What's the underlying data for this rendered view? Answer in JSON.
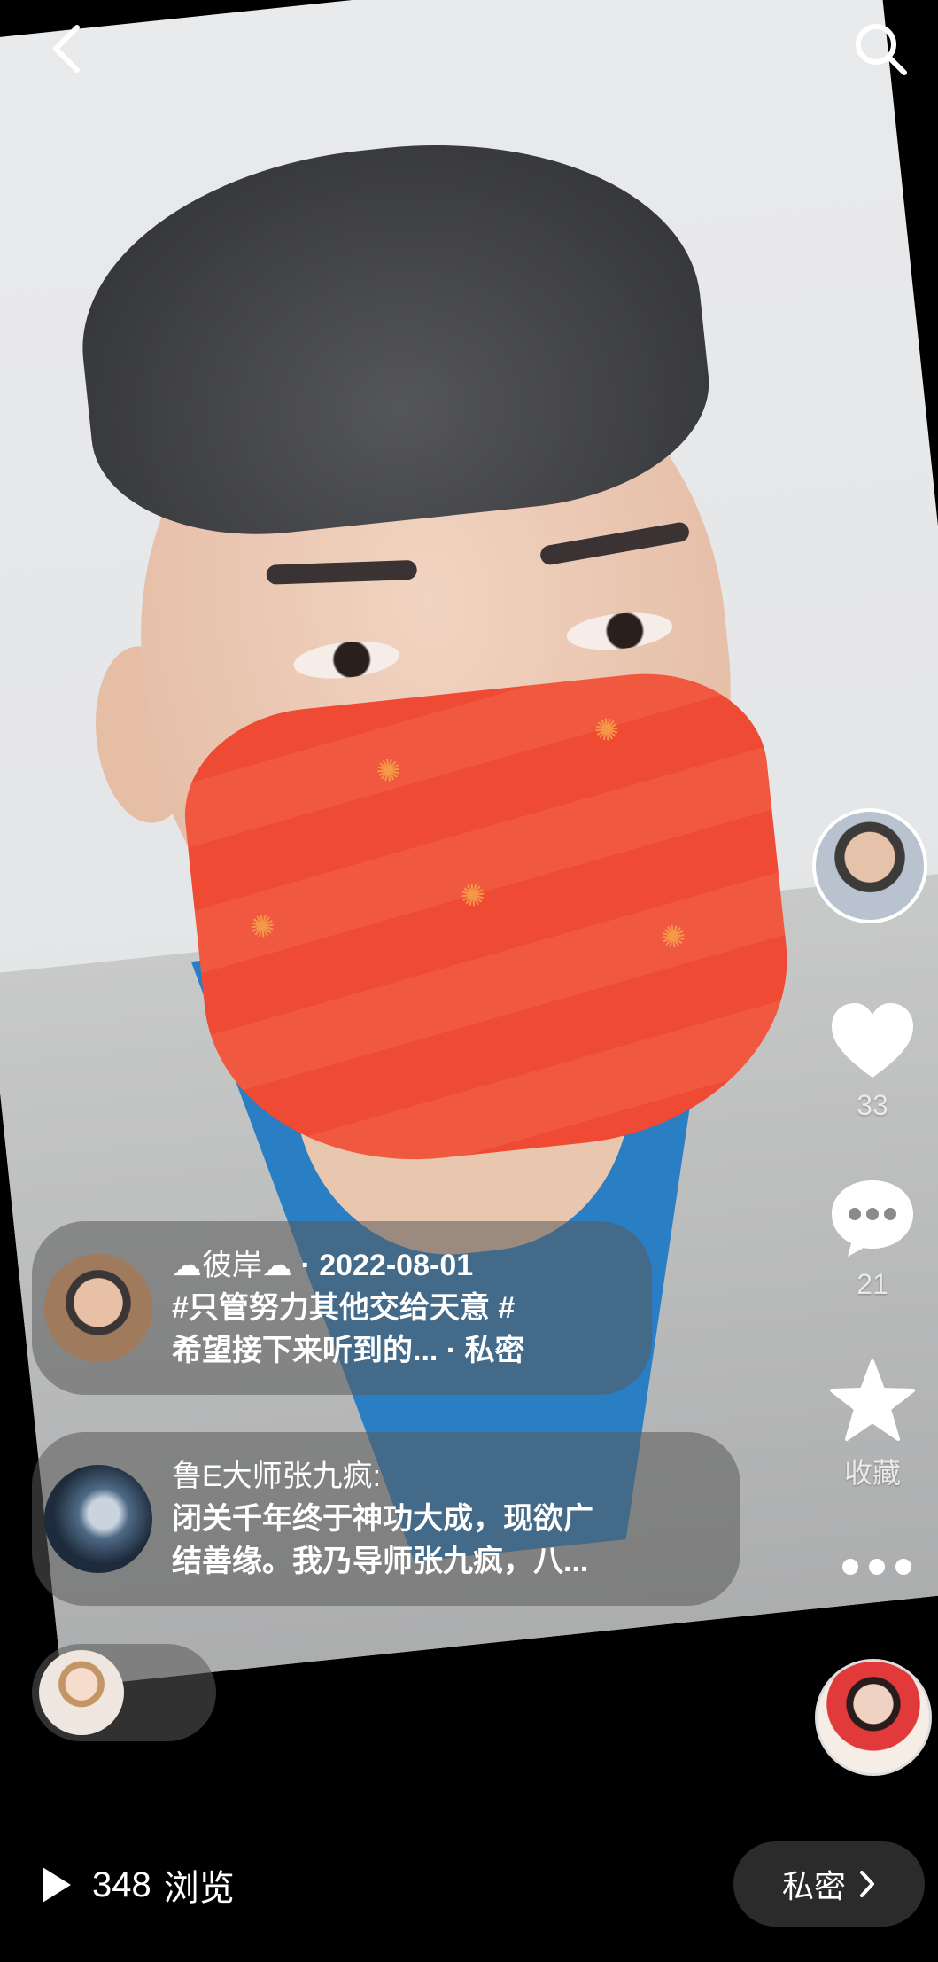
{
  "nav": {
    "back_icon": "chevron-left-icon",
    "search_icon": "search-icon"
  },
  "rail": {
    "author_avatar": "author-avatar",
    "like": {
      "icon": "heart-icon",
      "count": "33"
    },
    "comment": {
      "icon": "chat-bubble-icon",
      "count": "21"
    },
    "favorite": {
      "icon": "star-icon",
      "label": "收藏"
    },
    "more_icon": "more-dots-icon",
    "music_avatar": "music-avatar"
  },
  "post_info": {
    "author": "彼岸",
    "date_line": " · 2022-08-01",
    "line2": "#只管努力其他交给天意 #",
    "line3": "希望接下来听到的... · 私密"
  },
  "comments": [
    {
      "user": "鲁E大师张九疯:",
      "line1": "闭关千年终于神功大成，现欲广",
      "line2": "结善缘。我乃导师张九疯，八..."
    }
  ],
  "footer": {
    "views_count": "348",
    "views_label": "浏览",
    "privacy_button": "私密"
  }
}
